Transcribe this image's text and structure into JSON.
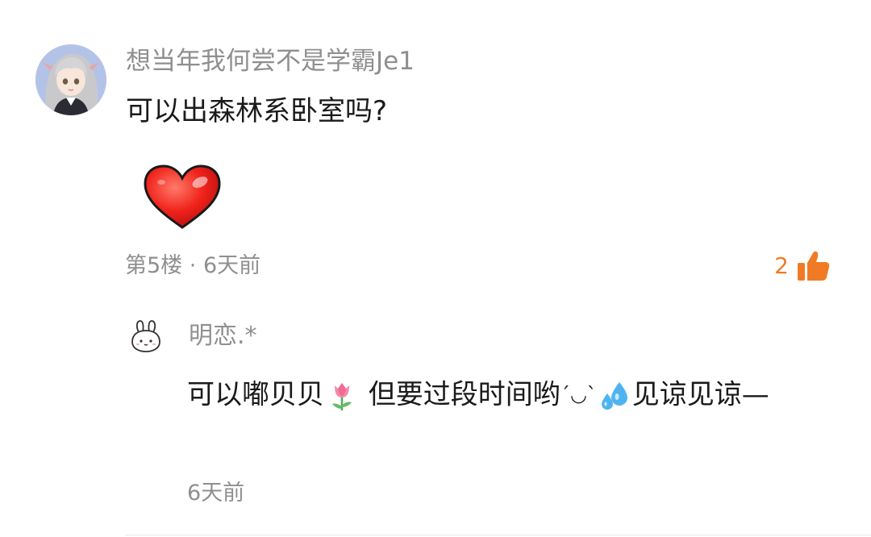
{
  "comment": {
    "username": "想当年我何尝不是学霸Je1",
    "text": "可以出森林系卧室吗?",
    "sticker_icon": "red-heart-sticker",
    "floor": "第5楼",
    "separator": "·",
    "time": "6天前",
    "like_count": "2",
    "like_icon": "thumbs-up-icon",
    "like_color": "#f07b24"
  },
  "reply": {
    "username": "明恋.*",
    "text_part1": "可以嘟贝贝",
    "emoji1": "tulip-emoji",
    "text_part2": " 但要过段时间哟",
    "emoticon": "´◡`",
    "emoji2": "sweat-droplets-emoji",
    "text_part3": "见谅见谅—",
    "time": "6天前"
  },
  "colors": {
    "primary_text": "#1a1a1a",
    "secondary_text": "#8f8f8f",
    "accent": "#f07b24"
  }
}
